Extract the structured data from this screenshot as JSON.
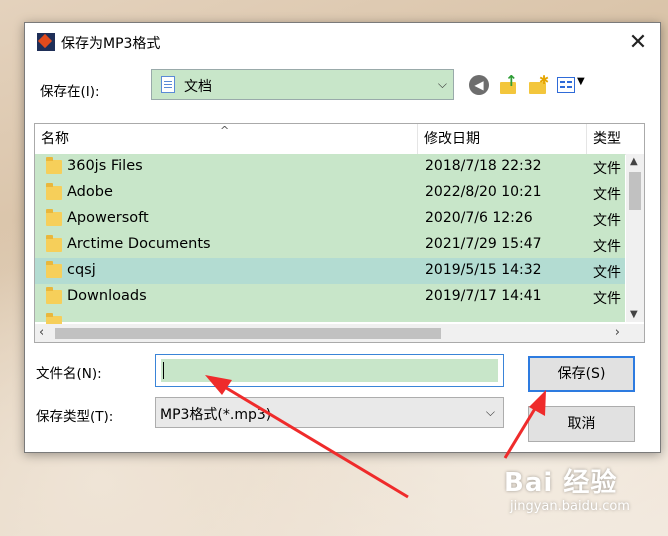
{
  "dialog": {
    "title": "保存为MP3格式",
    "close_glyph": "✕"
  },
  "location": {
    "label": "保存在(I):",
    "value": "文档",
    "toolbar_icons": [
      "back-icon",
      "up-folder-icon",
      "new-folder-icon",
      "view-menu-icon"
    ]
  },
  "filelist": {
    "columns": [
      "名称",
      "修改日期",
      "类型"
    ],
    "rows": [
      {
        "name": "360js Files",
        "date": "2018/7/18 22:32",
        "type": "文件"
      },
      {
        "name": "Adobe",
        "date": "2022/8/20 10:21",
        "type": "文件"
      },
      {
        "name": "Apowersoft",
        "date": "2020/7/6 12:26",
        "type": "文件"
      },
      {
        "name": "Arctime Documents",
        "date": "2021/7/29 15:47",
        "type": "文件"
      },
      {
        "name": "cqsj",
        "date": "2019/5/15 14:32",
        "type": "文件"
      },
      {
        "name": "Downloads",
        "date": "2019/7/17 14:41",
        "type": "文件"
      }
    ],
    "selected_index": 4
  },
  "filename": {
    "label": "文件名(N):",
    "value": ""
  },
  "filetype": {
    "label": "保存类型(T):",
    "value": "MP3格式(*.mp3)"
  },
  "buttons": {
    "save": "保存(S)",
    "cancel": "取消"
  },
  "watermark": {
    "main": "Bai  经验",
    "sub": "jingyan.baidu.com"
  },
  "colors": {
    "highlight_green": "#c8e6c9",
    "selected_row": "#b3dcd2",
    "arrow_red": "#ef2b2b",
    "focus_blue": "#2d7be0"
  }
}
